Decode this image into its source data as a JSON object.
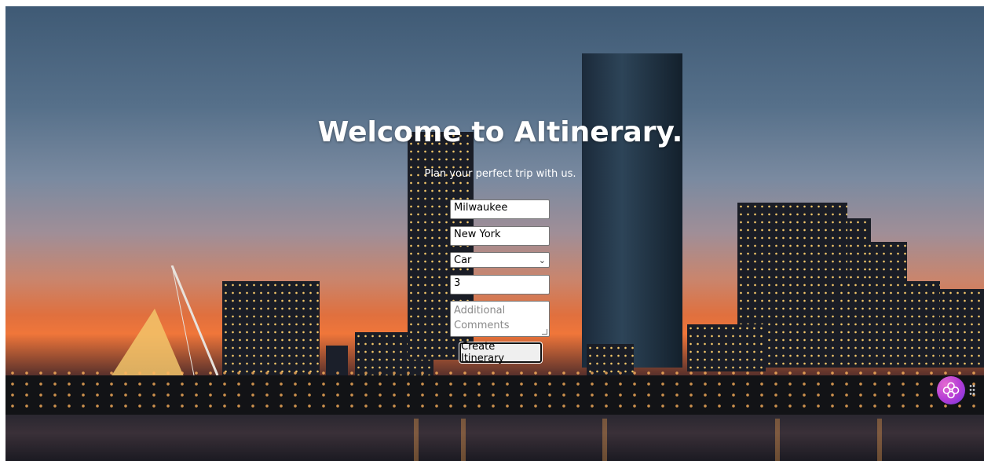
{
  "hero": {
    "title": "Welcome to AItinerary.",
    "subtitle": "Plan your perfect trip with us."
  },
  "form": {
    "origin_value": "Milwaukee",
    "destination_value": "New York",
    "transport_selected": "Car",
    "days_value": "3",
    "comments_placeholder": "Additional Comments",
    "submit_label": "Create Itinerary"
  },
  "icons": {
    "dropdown": "chevron-down-icon",
    "assistant": "assistant-flower-icon",
    "drag": "drag-handle-icon"
  },
  "colors": {
    "title_text": "#ffffff",
    "assistant_gradient": "#b23bd6"
  }
}
